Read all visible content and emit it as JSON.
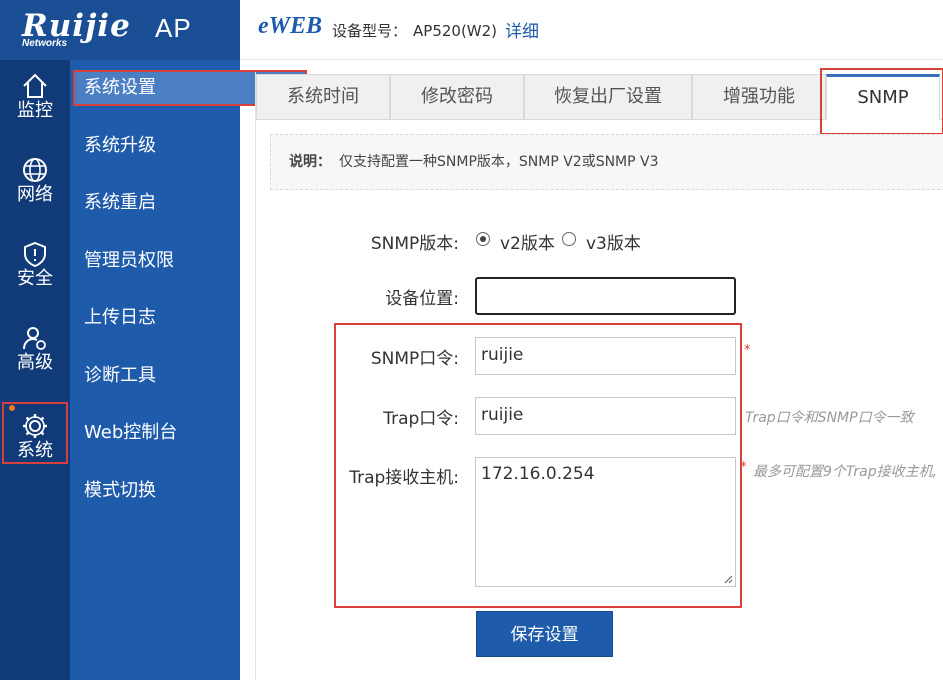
{
  "logo": {
    "brand": "Ruijie",
    "sub": "Networks",
    "product": "AP"
  },
  "header": {
    "eweb": "eWEB",
    "model_label": "设备型号：",
    "model_value": "AP520(W2)",
    "detail_link": "详细"
  },
  "nav": {
    "items": [
      {
        "label": "监控",
        "icon": "monitor-home-icon"
      },
      {
        "label": "网络",
        "icon": "network-globe-icon"
      },
      {
        "label": "安全",
        "icon": "security-shield-icon"
      },
      {
        "label": "高级",
        "icon": "advanced-user-icon"
      },
      {
        "label": "系统",
        "icon": "system-gear-icon",
        "active": true
      }
    ]
  },
  "subnav": {
    "items": [
      "系统设置",
      "系统升级",
      "系统重启",
      "管理员权限",
      "上传日志",
      "诊断工具",
      "Web控制台",
      "模式切换"
    ],
    "active_index": 0
  },
  "tabs": {
    "items": [
      "系统时间",
      "修改密码",
      "恢复出厂设置",
      "增强功能",
      "SNMP"
    ],
    "active_index": 4
  },
  "note": {
    "label": "说明：",
    "text": "仅支持配置一种SNMP版本，SNMP V2或SNMP V3"
  },
  "form": {
    "version_label": "SNMP版本:",
    "version_v2": "v2版本",
    "version_v3": "v3版本",
    "version_selected": "v2",
    "location_label": "设备位置:",
    "location_value": "",
    "community_label": "SNMP口令:",
    "community_value": "ruijie",
    "trap_label": "Trap口令:",
    "trap_value": "ruijie",
    "trap_hint": "Trap口令和SNMP口令一致",
    "trap_host_label": "Trap接收主机:",
    "trap_host_value": "172.16.0.254",
    "trap_host_hint": "最多可配置9个Trap接收主机,",
    "required_mark": "*"
  },
  "save_button": "保存设置",
  "colors": {
    "nav_dark": "#113a78",
    "subnav": "#1f5bab",
    "accent": "#1f5bab",
    "highlight_red": "#d9403b",
    "notify_dot": "#f07a1f"
  }
}
